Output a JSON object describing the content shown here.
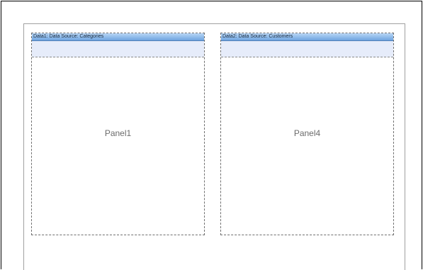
{
  "panels": [
    {
      "header": "Data1: Data Source: Categories",
      "label": "Panel1"
    },
    {
      "header": "Data2: Data Source: Customers",
      "label": "Panel4"
    }
  ],
  "colors": {
    "header_gradient_top": "#b9d6f5",
    "header_gradient_bottom": "#6fa3de",
    "band_body": "#e6ecfa",
    "panel_border": "#707070",
    "label_text": "#6b6b6b"
  }
}
